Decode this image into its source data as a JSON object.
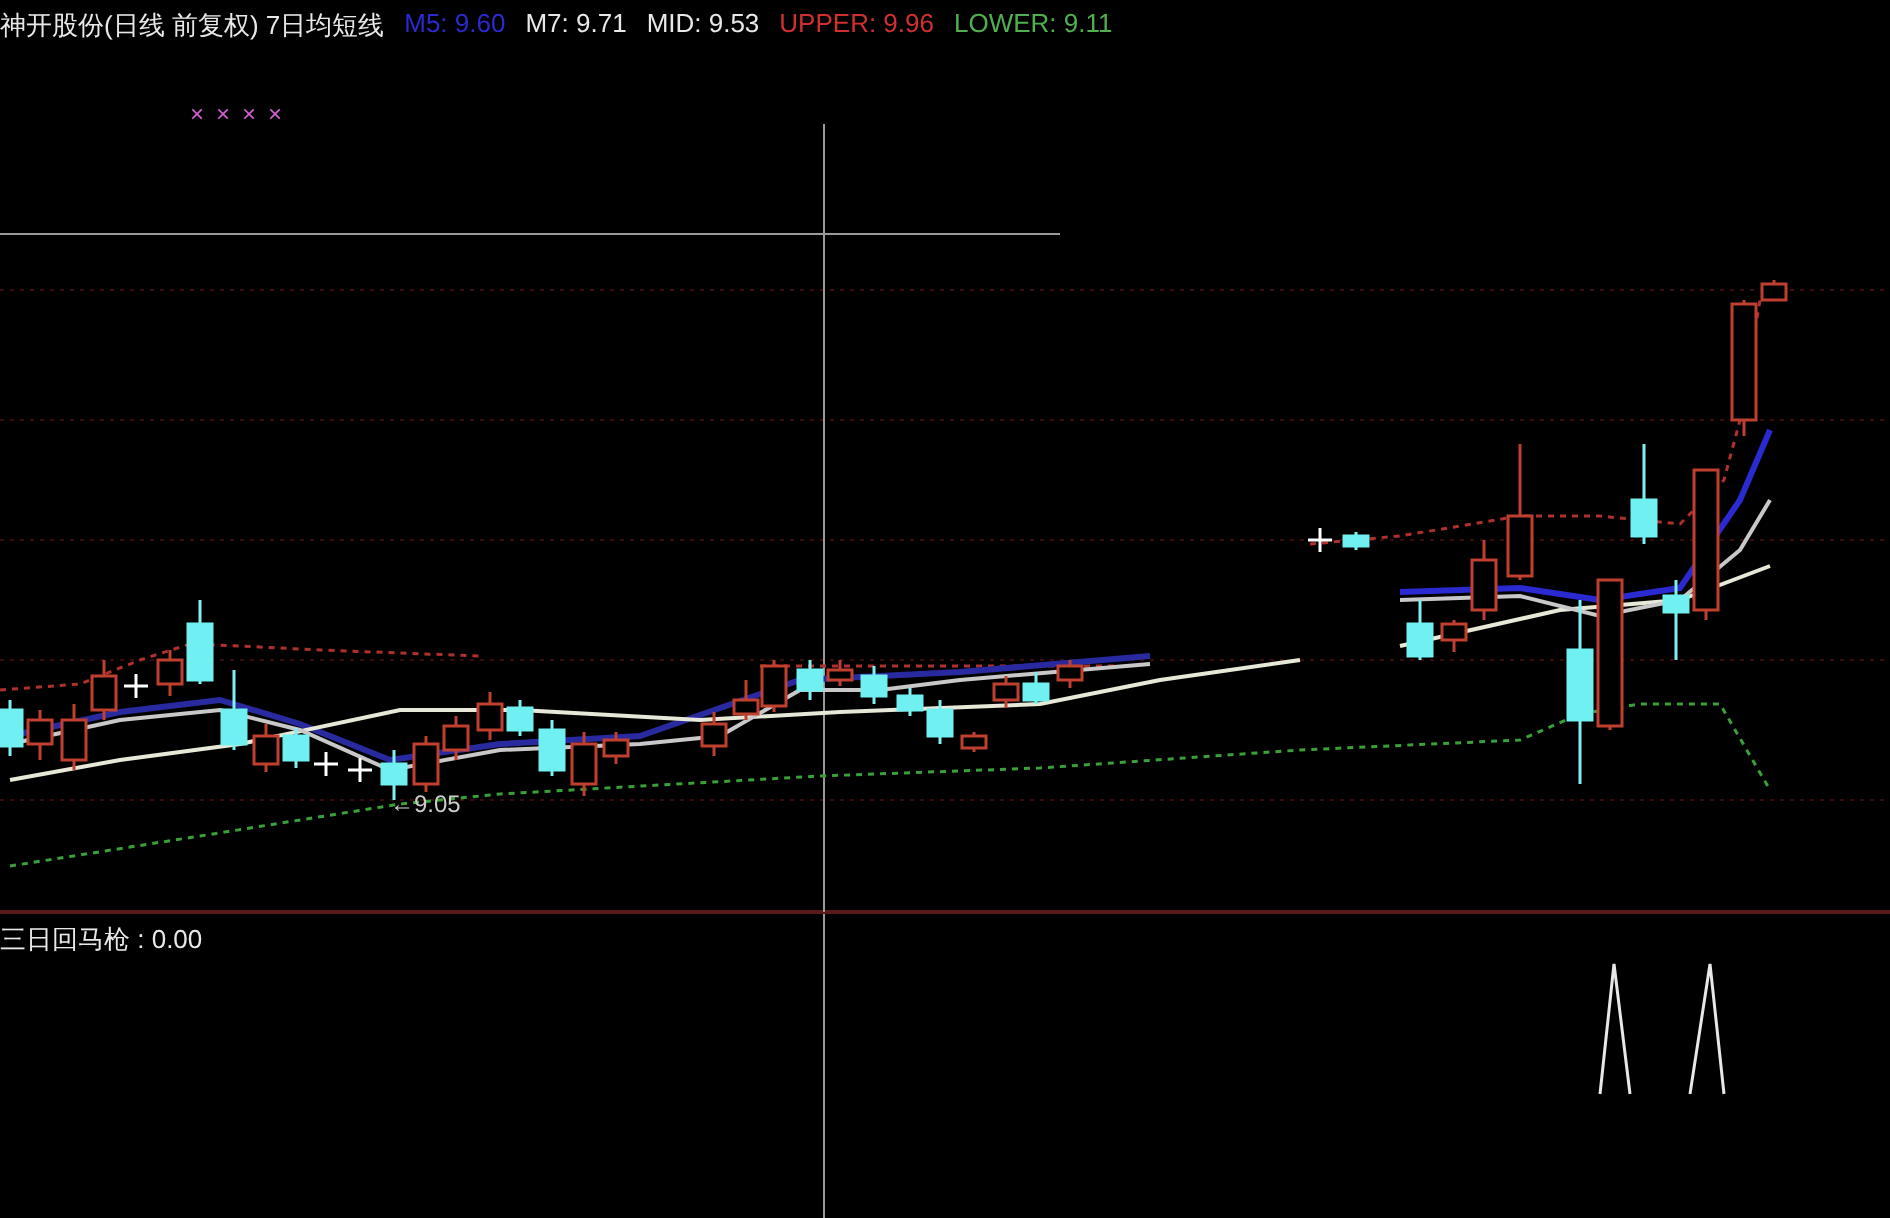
{
  "header": {
    "title": "神开股份(日线 前复权) 7日均短线",
    "indicators": [
      {
        "label": "M5: 9.60",
        "color": "#2a2ad0"
      },
      {
        "label": "M7: 9.71",
        "color": "#e8e8e8"
      },
      {
        "label": "MID: 9.53",
        "color": "#e8e8e8"
      },
      {
        "label": "UPPER: 9.96",
        "color": "#d03030"
      },
      {
        "label": "LOWER: 9.11",
        "color": "#50b050"
      }
    ]
  },
  "signal_marks": [
    "×",
    "×",
    "×",
    "×"
  ],
  "price_chart": {
    "low_label": "←9.05"
  },
  "sub_chart": {
    "label": "三日回马枪 : 0.00"
  }
}
